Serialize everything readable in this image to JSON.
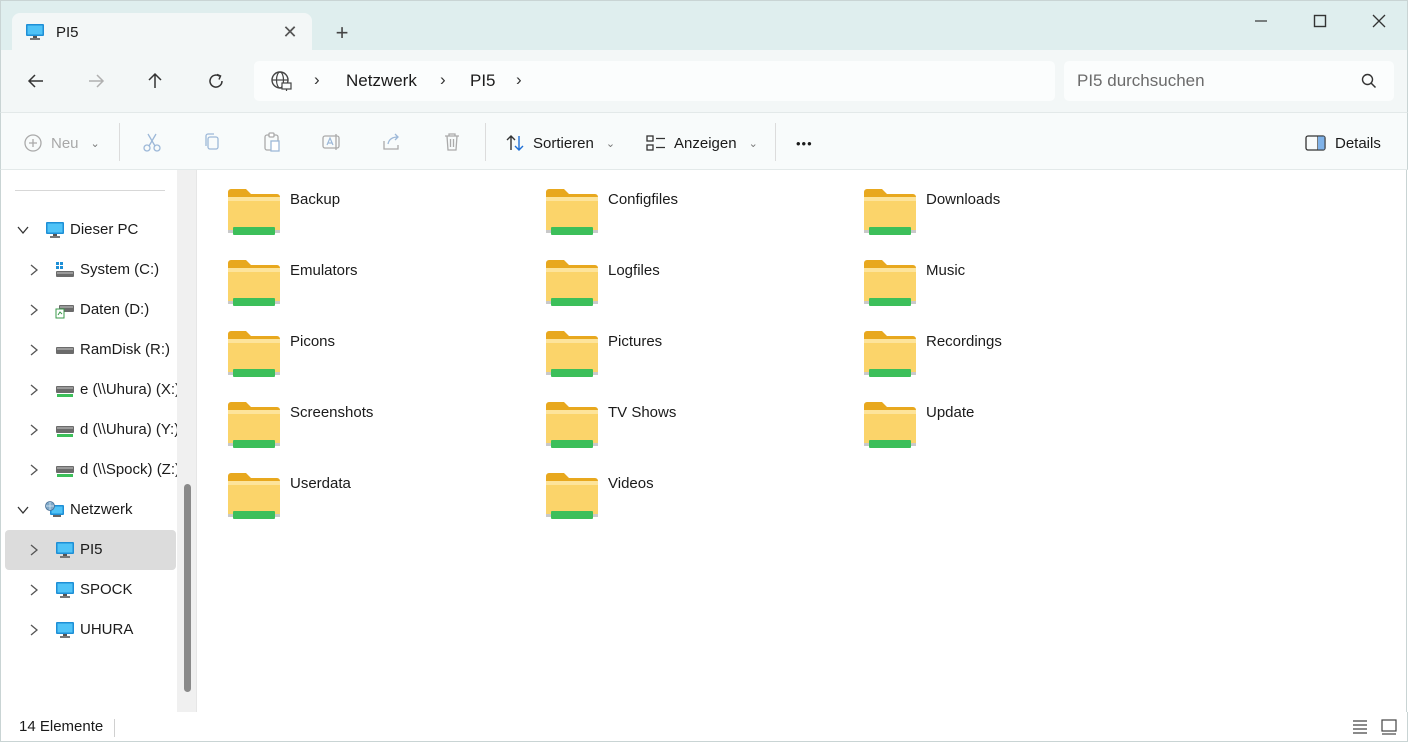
{
  "window": {
    "tab_title": "PI5",
    "new_tab_symbol": "+",
    "close_tab_symbol": "✕"
  },
  "nav": {
    "breadcrumb": [
      "Netzwerk",
      "PI5"
    ],
    "search_placeholder": "PI5 durchsuchen"
  },
  "commands": {
    "new_label": "Neu",
    "sort_label": "Sortieren",
    "view_label": "Anzeigen",
    "more_label": "•••",
    "details_label": "Details"
  },
  "sidebar": {
    "items": [
      {
        "label": "Dieser PC",
        "icon": "monitor-icon"
      },
      {
        "label": "System (C:)",
        "icon": "windows-drive-icon"
      },
      {
        "label": "Daten (D:)",
        "icon": "drive-icon"
      },
      {
        "label": "RamDisk (R:)",
        "icon": "drive-icon"
      },
      {
        "label": "e (\\\\Uhura) (X:)",
        "icon": "network-drive-icon"
      },
      {
        "label": "d (\\\\Uhura) (Y:)",
        "icon": "network-drive-icon"
      },
      {
        "label": "d (\\\\Spock) (Z:)",
        "icon": "network-drive-icon"
      },
      {
        "label": "Netzwerk",
        "icon": "network-icon"
      },
      {
        "label": "PI5",
        "icon": "monitor-icon"
      },
      {
        "label": "SPOCK",
        "icon": "monitor-icon"
      },
      {
        "label": "UHURA",
        "icon": "monitor-icon"
      }
    ]
  },
  "folders": [
    "Backup",
    "Configfiles",
    "Downloads",
    "Emulators",
    "Logfiles",
    "Music",
    "Picons",
    "Pictures",
    "Recordings",
    "Screenshots",
    "TV Shows",
    "Update",
    "Userdata",
    "Videos"
  ],
  "status": {
    "count_text": "14 Elemente"
  },
  "colors": {
    "titlebar_bg": "#dfeeee",
    "folder_yellow": "#f8c94a",
    "share_green": "#3cbf5a",
    "selection_gray": "#dcdcdc"
  }
}
